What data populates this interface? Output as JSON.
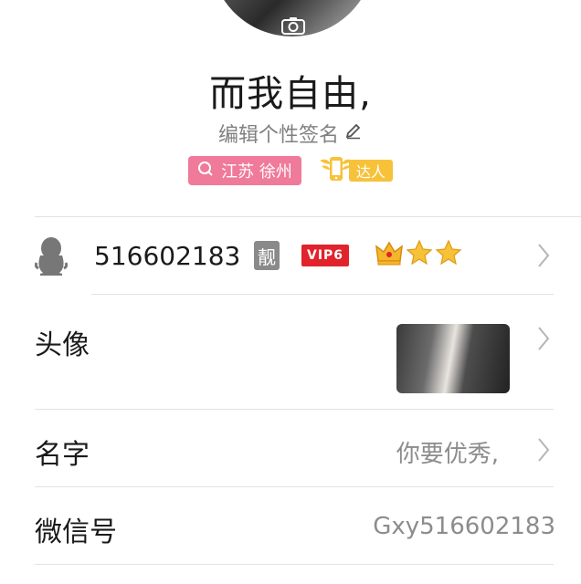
{
  "profile": {
    "nickname": "而我自由,",
    "signature": "编辑个性签名",
    "location": "江苏 徐州",
    "daren_label": "达人"
  },
  "qq_row": {
    "number": "516602183",
    "liang_badge": "靓",
    "vip_badge": "VIP6"
  },
  "rows": {
    "avatar_label": "头像",
    "name_label": "名字",
    "name_value": "你要优秀,",
    "wechat_label": "微信号",
    "wechat_value": "Gxy516602183"
  },
  "colors": {
    "location_tag": "#ef7a9a",
    "daren_tag": "#f7c23a",
    "vip": "#e0232c"
  }
}
